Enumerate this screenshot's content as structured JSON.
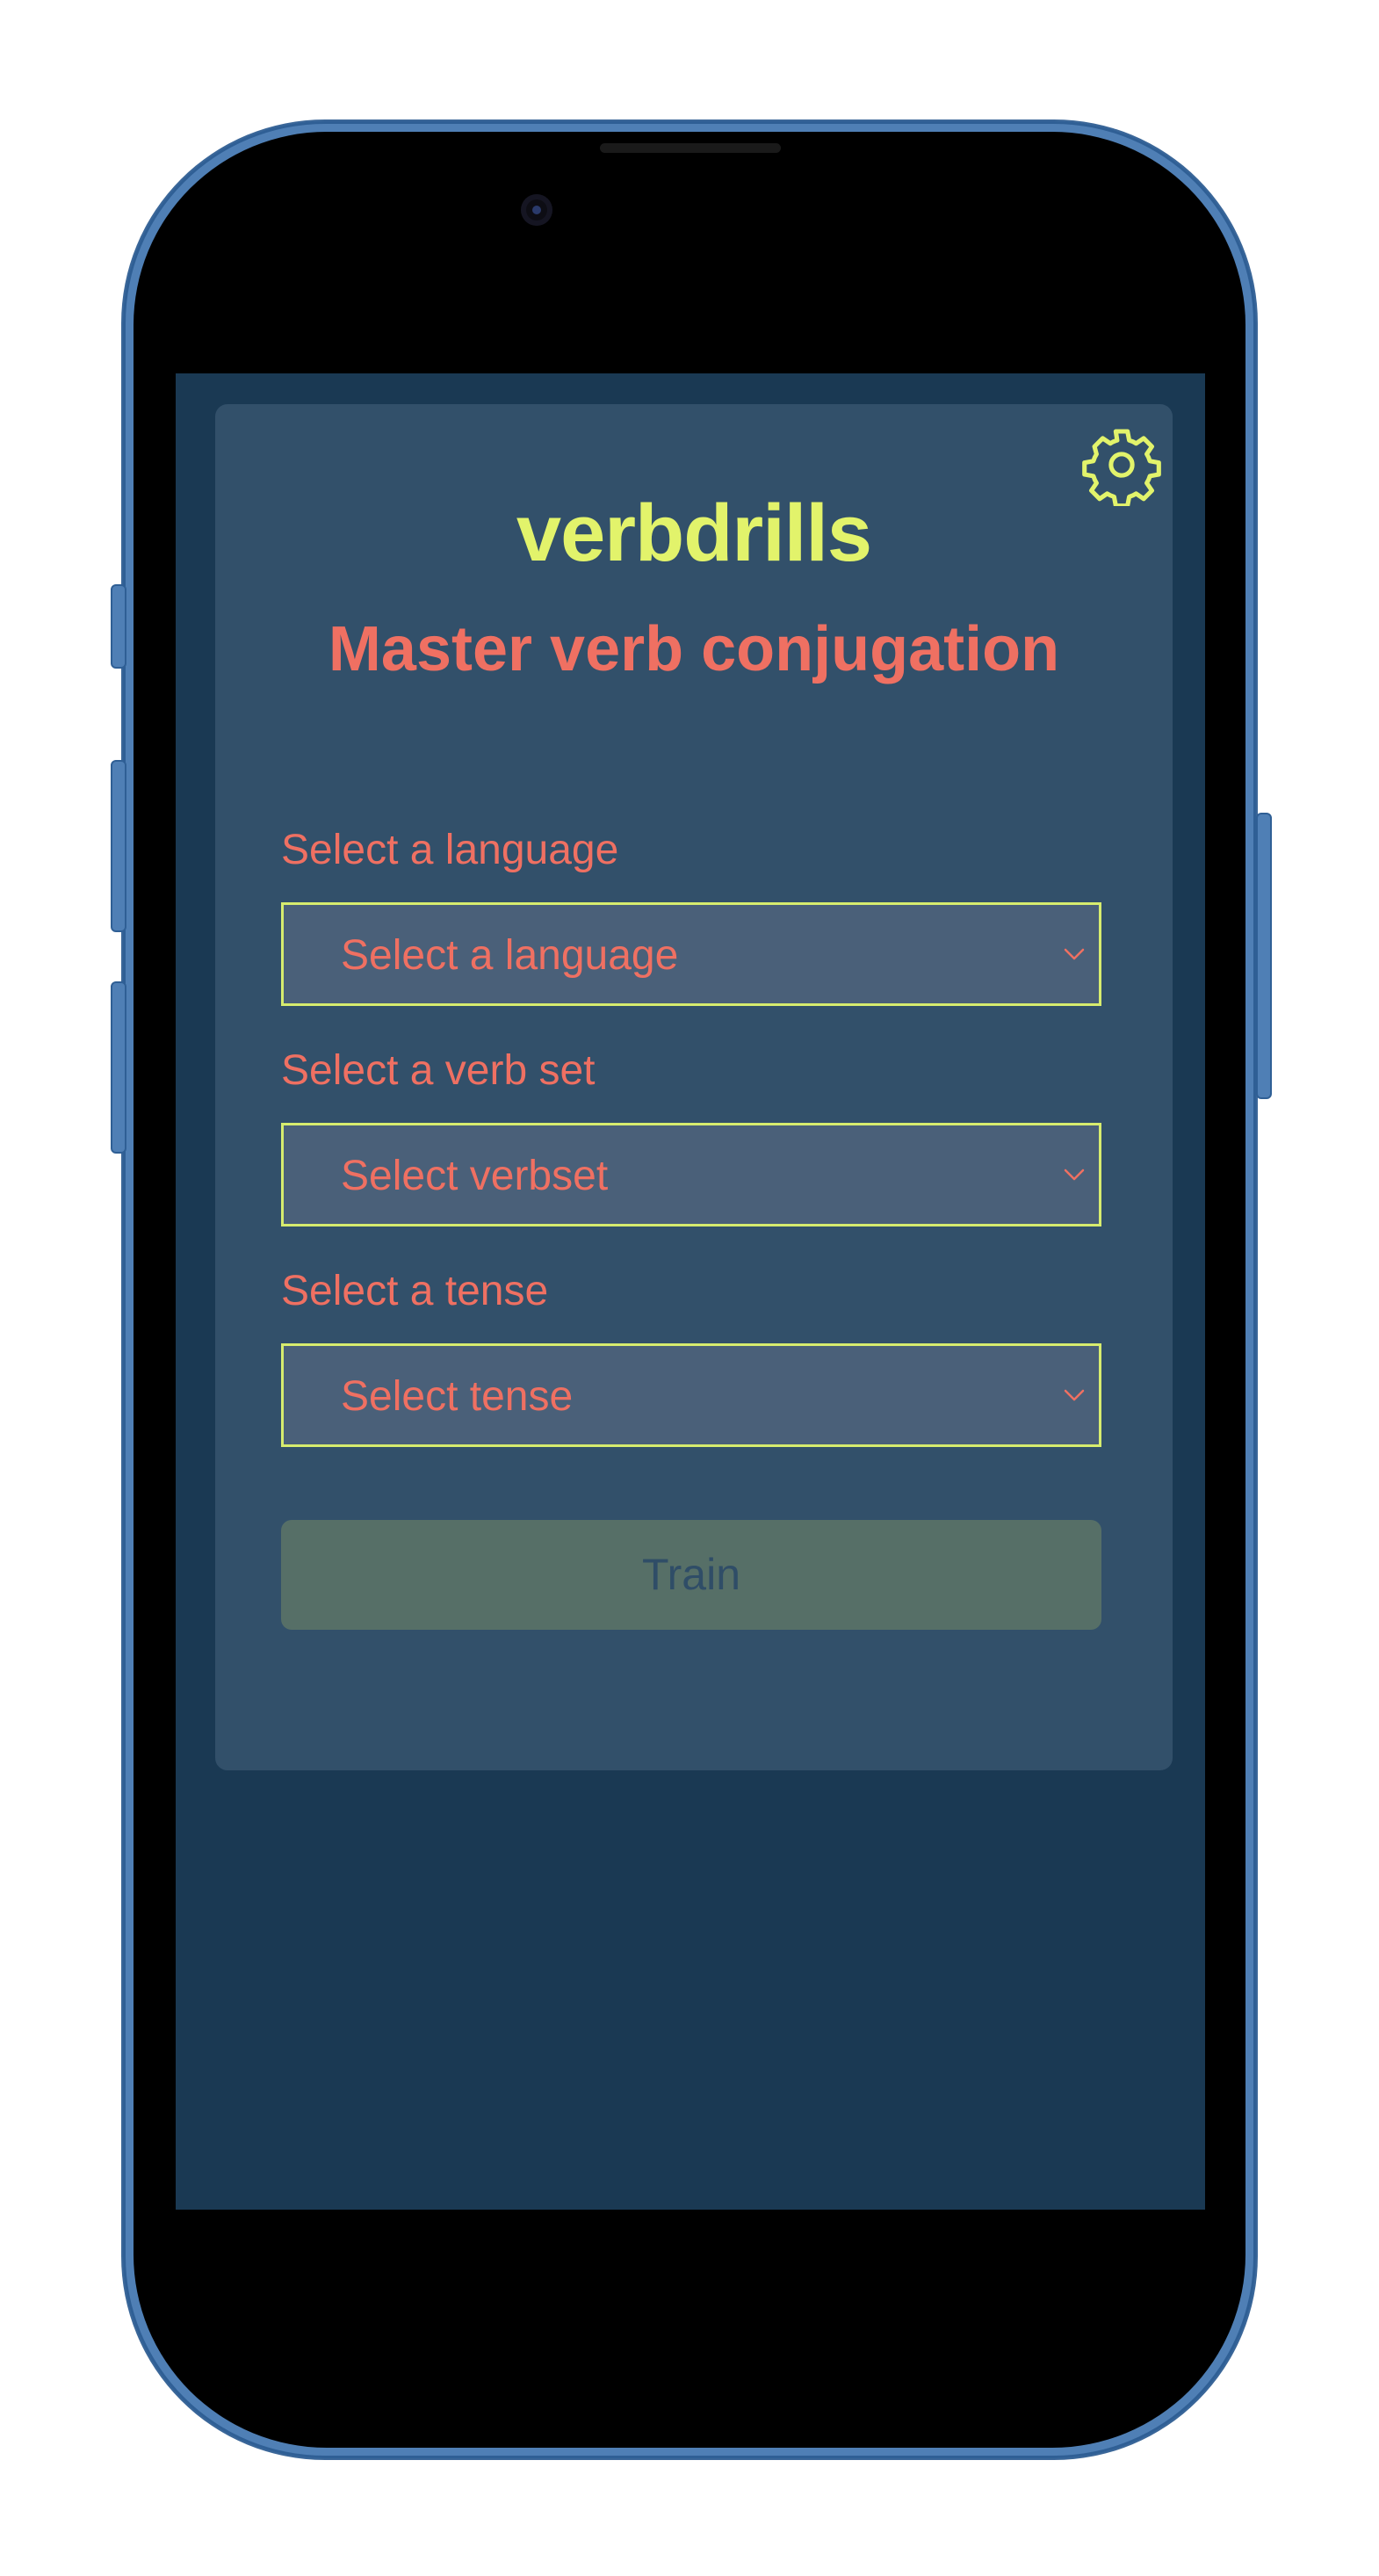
{
  "app": {
    "brand": "verbdrills",
    "tagline": "Master verb conjugation"
  },
  "form": {
    "language": {
      "label": "Select a language",
      "selected": "Select a language"
    },
    "verbset": {
      "label": "Select a verb set",
      "selected": "Select verbset"
    },
    "tense": {
      "label": "Select a tense",
      "selected": "Select tense"
    },
    "train_label": "Train"
  },
  "icons": {
    "settings": "gear-icon",
    "dropdown": "chevron-down-icon"
  },
  "colors": {
    "background": "#1a3953",
    "card": "#32506a",
    "brand": "#e2f36b",
    "accent": "#ef7062",
    "select_border": "#d7ec6e",
    "select_fill": "#4a6079",
    "train_button": "#566f67",
    "train_text": "#2f4d67",
    "device_frame": "#4f7fb5"
  }
}
